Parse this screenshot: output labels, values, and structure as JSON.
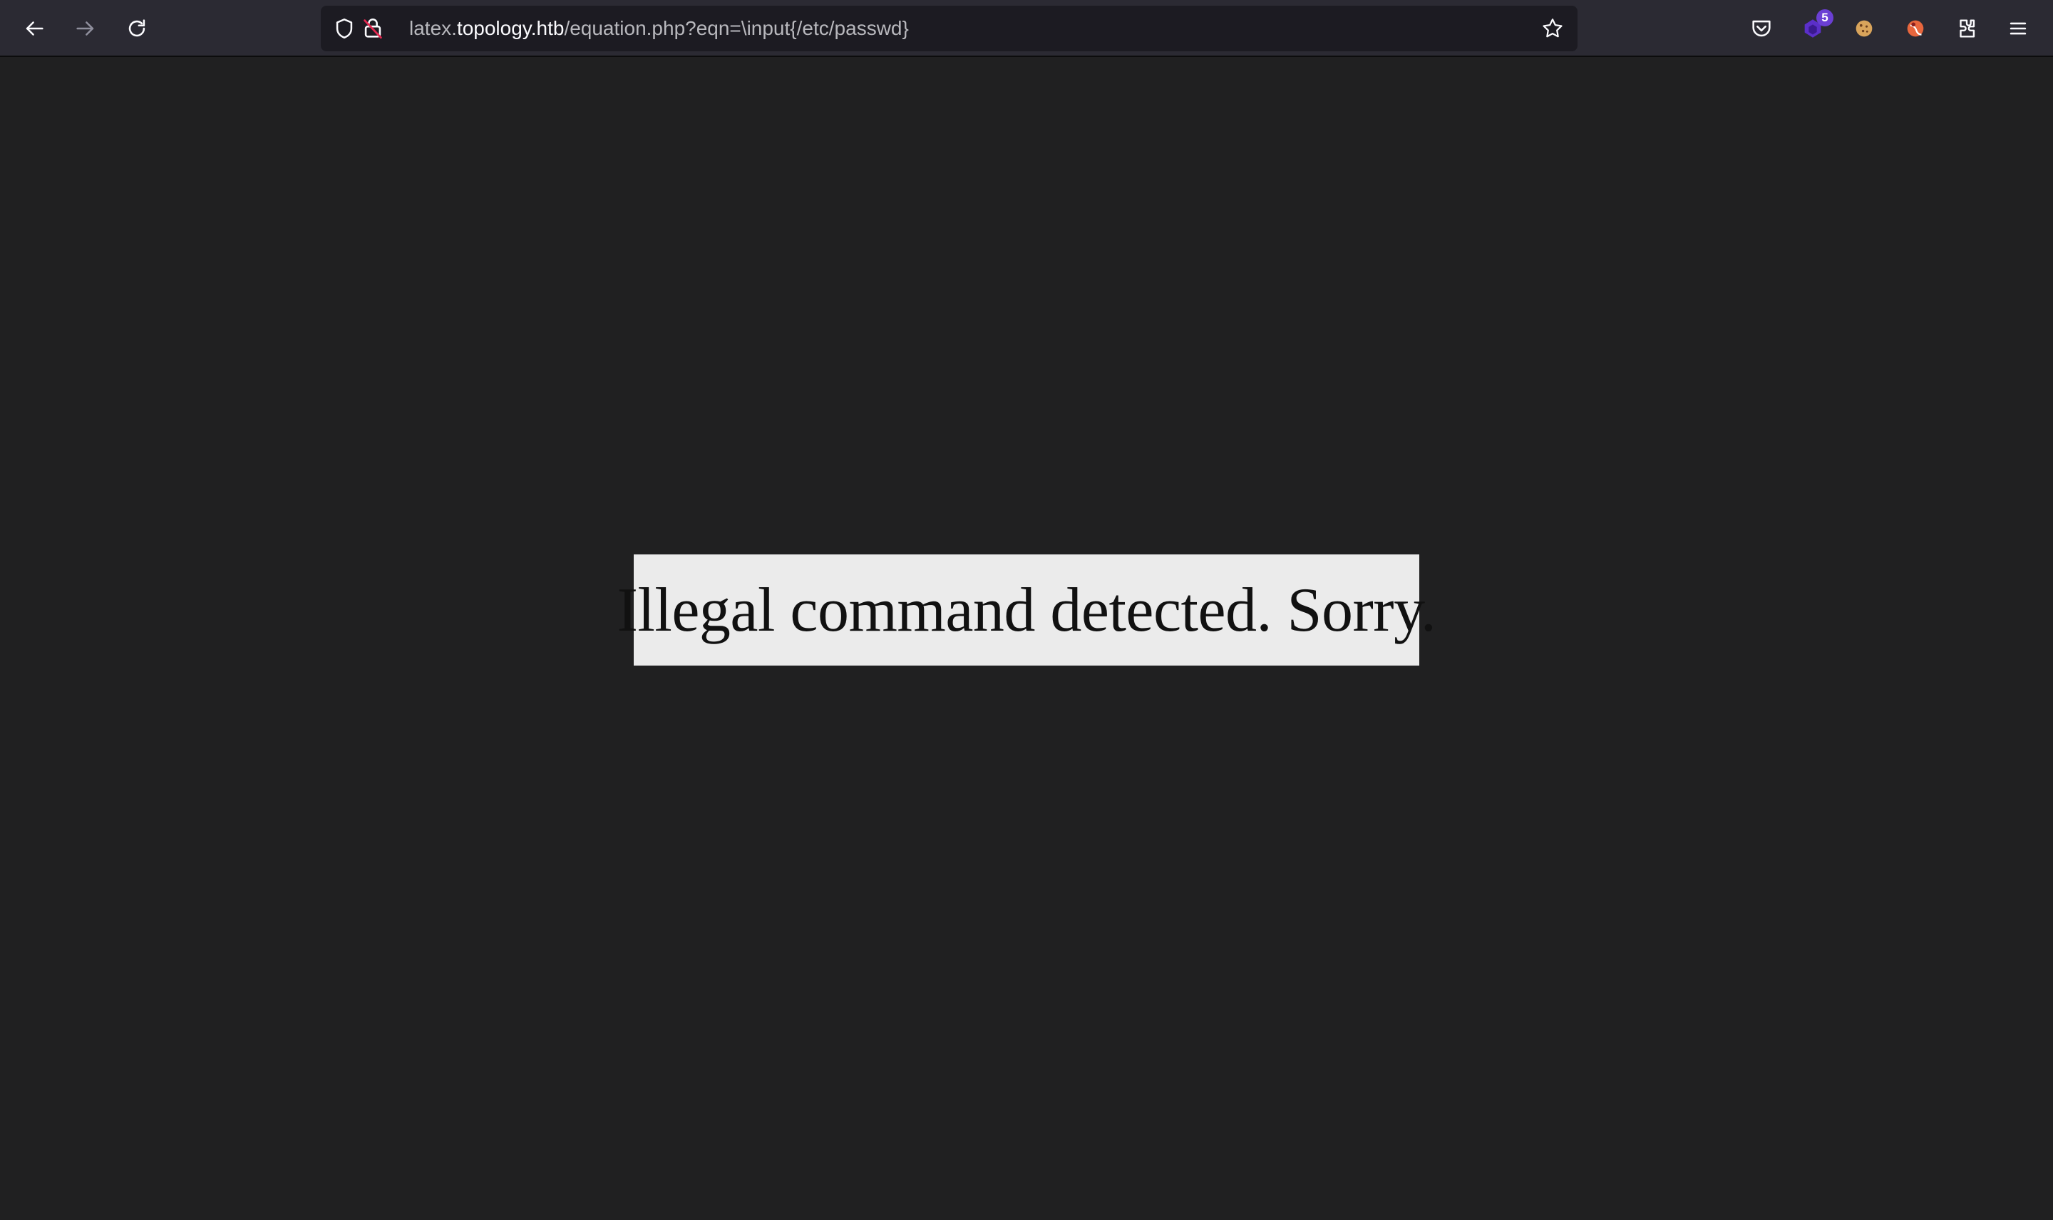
{
  "browser": {
    "url": {
      "prefix": "latex.",
      "domain": "topology.htb",
      "path": "/equation.php?eqn=\\input{/etc/passwd}"
    },
    "nav": {
      "back_icon": "arrow-left-icon",
      "forward_icon": "arrow-right-icon",
      "reload_icon": "reload-icon"
    },
    "urlbar_icons": {
      "tracking_protection": "shield-icon",
      "connection": "insecure-lock-icon",
      "bookmark": "star-icon"
    },
    "toolbar_icons": [
      {
        "name": "pocket-icon"
      },
      {
        "name": "extension-purple-icon",
        "badge": "5"
      },
      {
        "name": "cookie-icon"
      },
      {
        "name": "extension-orange-icon"
      },
      {
        "name": "extensions-puzzle-icon"
      },
      {
        "name": "menu-hamburger-icon"
      }
    ]
  },
  "page": {
    "message": "Illegal command detected. Sorry."
  },
  "colors": {
    "toolbar_bg": "#2b2a33",
    "urlbar_bg": "#1c1b22",
    "page_bg": "#202021",
    "message_bg": "#ebebeb",
    "badge_bg": "#6b3fd4"
  }
}
